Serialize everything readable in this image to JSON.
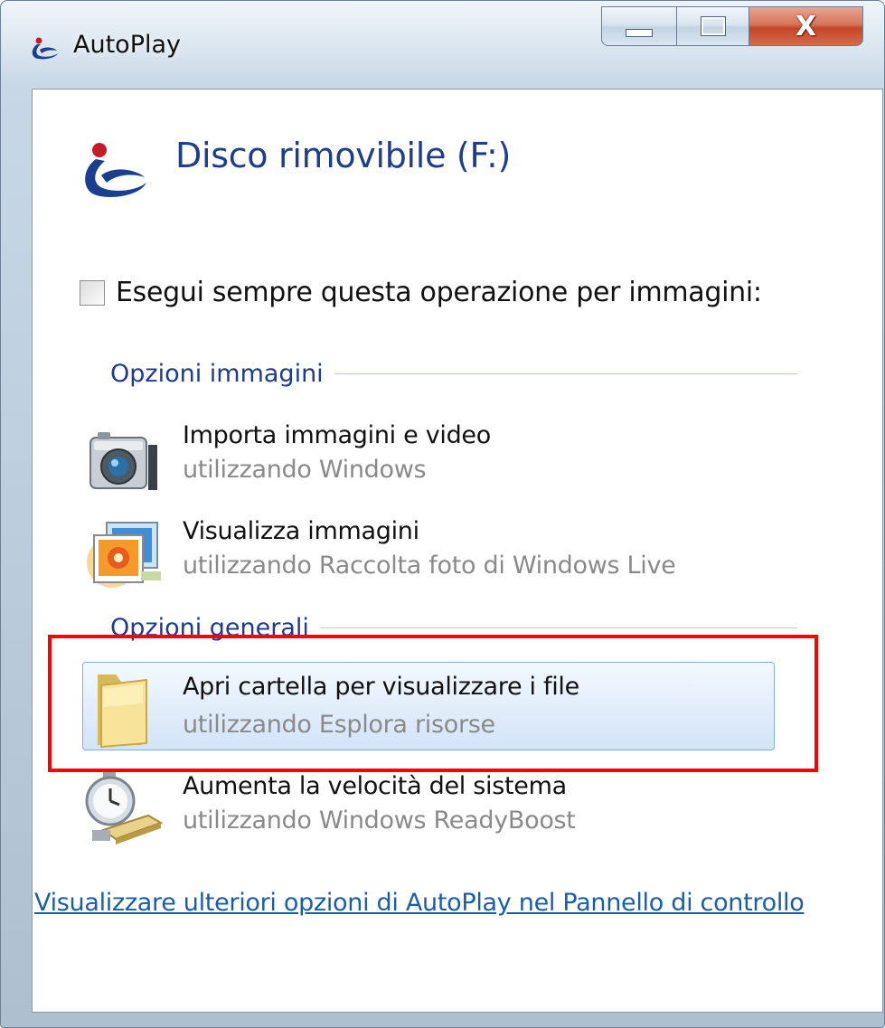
{
  "window": {
    "title": "AutoPlay",
    "title_icon": "autoplay-icon",
    "buttons": {
      "minimize": "minimize-button",
      "maximize": "maximize-button",
      "close": "close-button",
      "close_glyph": "X"
    }
  },
  "device": {
    "name": "Disco rimovibile (F:)",
    "icon": "autoplay-icon"
  },
  "always_checkbox": {
    "label": "Esegui sempre questa operazione per immagini:",
    "checked": false
  },
  "sections": [
    {
      "label": "Opzioni immagini",
      "options": [
        {
          "title": "Importa immagini e video",
          "subtitle": "utilizzando Windows",
          "icon": "camera-icon"
        },
        {
          "title": "Visualizza immagini",
          "subtitle": "utilizzando Raccolta foto di Windows Live",
          "icon": "photo-gallery-icon"
        }
      ]
    },
    {
      "label": "Opzioni generali",
      "options": [
        {
          "title": "Apri cartella per visualizzare i file",
          "subtitle": "utilizzando Esplora risorse",
          "icon": "folder-icon",
          "selected": true
        },
        {
          "title": "Aumenta la velocità del sistema",
          "subtitle": "utilizzando Windows ReadyBoost",
          "icon": "readyboost-icon"
        }
      ]
    }
  ],
  "control_panel_link": "Visualizzare ulteriori opzioni di AutoPlay nel Pannello di controllo",
  "colors": {
    "heading": "#1f3d8f",
    "link": "#1b5ea8",
    "highlight": "#ff0000"
  }
}
